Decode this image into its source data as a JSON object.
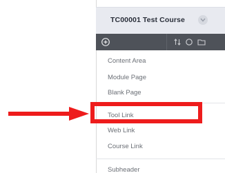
{
  "course": {
    "title": "TC00001 Test Course"
  },
  "toolbar": {
    "icons": [
      "add-circle-icon",
      "reorder-icon",
      "refresh-icon",
      "folder-icon"
    ]
  },
  "menu": {
    "items": [
      {
        "label": "Content Area"
      },
      {
        "label": "Module Page"
      },
      {
        "label": "Blank Page"
      },
      {
        "label": "Tool Link"
      },
      {
        "label": "Web Link"
      },
      {
        "label": "Course Link"
      },
      {
        "label": "Subheader"
      }
    ]
  },
  "annotation": {
    "highlight_color": "#ee1c1c",
    "highlighted_item": "Tool Link"
  },
  "colors": {
    "header_bg": "#e8eaf0",
    "toolbar_bg": "#4e5259",
    "menu_text": "#6b6f76"
  }
}
